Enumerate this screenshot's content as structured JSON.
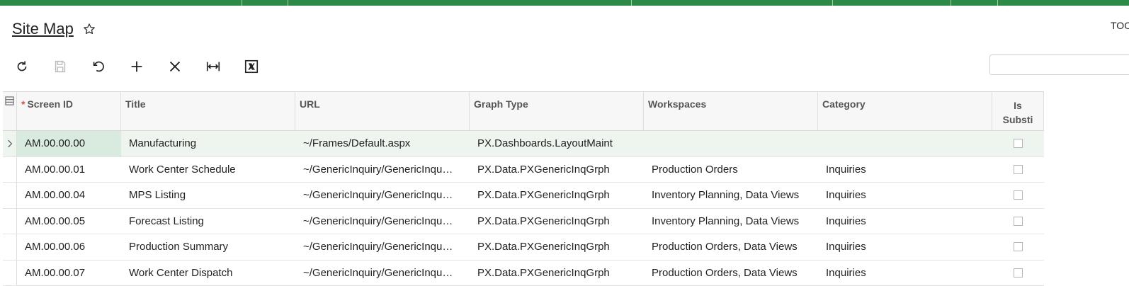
{
  "header": {
    "title": "Site Map",
    "tools_label": "TOOLS"
  },
  "toolbar": {
    "buttons": [
      {
        "name": "refresh",
        "icon": "refresh-icon"
      },
      {
        "name": "save",
        "icon": "save-icon"
      },
      {
        "name": "undo",
        "icon": "undo-icon"
      },
      {
        "name": "add",
        "icon": "plus-icon"
      },
      {
        "name": "delete",
        "icon": "close-icon"
      },
      {
        "name": "fit-to-screen",
        "icon": "fit-width-icon"
      },
      {
        "name": "export-excel",
        "icon": "excel-icon"
      }
    ]
  },
  "search": {
    "value": ""
  },
  "grid": {
    "columns": {
      "screen_id": "Screen ID",
      "title": "Title",
      "url": "URL",
      "graph_type": "Graph Type",
      "workspaces": "Workspaces",
      "category": "Category",
      "is_substitute": "Is\nSubsti"
    },
    "rows": [
      {
        "screen_id": "AM.00.00.00",
        "title": "Manufacturing",
        "url": "~/Frames/Default.aspx",
        "graph_type": "PX.Dashboards.LayoutMaint",
        "workspaces": "",
        "category": "",
        "is_substitute": false
      },
      {
        "screen_id": "AM.00.00.01",
        "title": "Work Center Schedule",
        "url": "~/GenericInquiry/GenericInqu…",
        "graph_type": "PX.Data.PXGenericInqGrph",
        "workspaces": "Production Orders",
        "category": "Inquiries",
        "is_substitute": false
      },
      {
        "screen_id": "AM.00.00.04",
        "title": "MPS Listing",
        "url": "~/GenericInquiry/GenericInqu…",
        "graph_type": "PX.Data.PXGenericInqGrph",
        "workspaces": "Inventory Planning, Data Views",
        "category": "Inquiries",
        "is_substitute": false
      },
      {
        "screen_id": "AM.00.00.05",
        "title": "Forecast Listing",
        "url": "~/GenericInquiry/GenericInqu…",
        "graph_type": "PX.Data.PXGenericInqGrph",
        "workspaces": "Inventory Planning, Data Views",
        "category": "Inquiries",
        "is_substitute": false
      },
      {
        "screen_id": "AM.00.00.06",
        "title": "Production Summary",
        "url": "~/GenericInquiry/GenericInqu…",
        "graph_type": "PX.Data.PXGenericInqGrph",
        "workspaces": "Production Orders, Data Views",
        "category": "Inquiries",
        "is_substitute": false
      },
      {
        "screen_id": "AM.00.00.07",
        "title": "Work Center Dispatch",
        "url": "~/GenericInquiry/GenericInqu…",
        "graph_type": "PX.Data.PXGenericInqGrph",
        "workspaces": "Production Orders, Data Views",
        "category": "Inquiries",
        "is_substitute": false
      }
    ]
  },
  "colors": {
    "brand_bar": "#2a8a46",
    "selected_row": "#eef5ee",
    "required_asterisk": "#d9534f"
  }
}
